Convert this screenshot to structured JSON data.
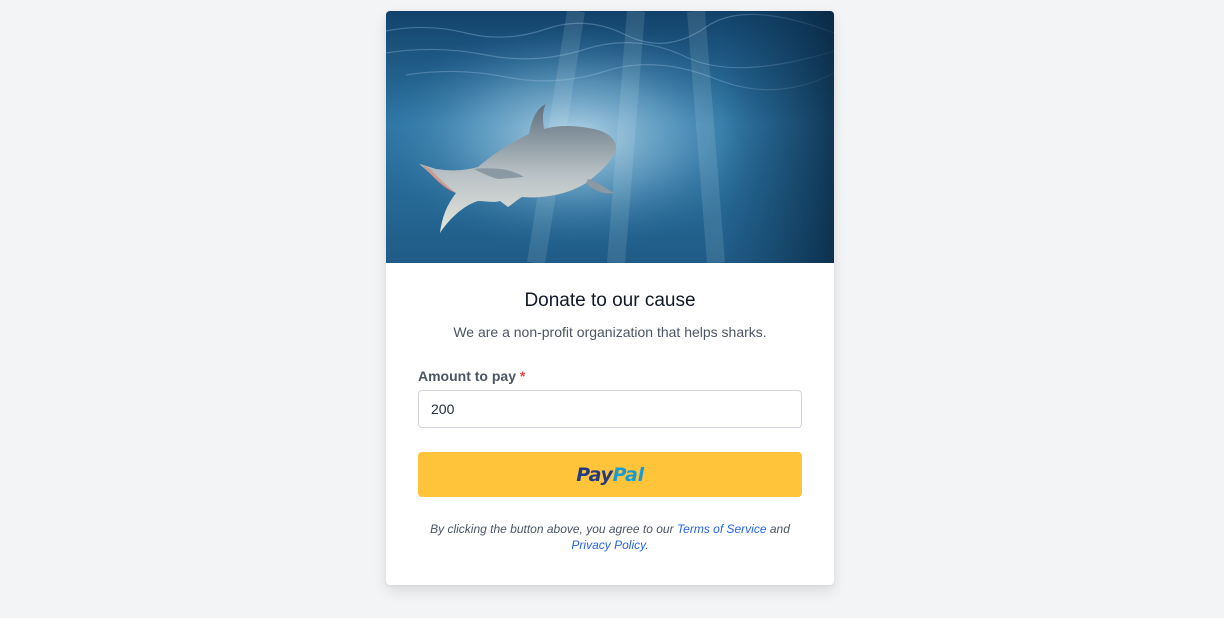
{
  "donation": {
    "hero_image_icon": "shark-underwater-image",
    "title": "Donate to our cause",
    "subtitle": "We are a non-profit organization that helps sharks.",
    "amount_label": "Amount to pay",
    "required_marker": "*",
    "amount_value": "200",
    "paypal_button": {
      "label_part1": "Pay",
      "label_part2": "Pal"
    },
    "terms": {
      "text_before": "By clicking the button above, you agree to our ",
      "terms_link": "Terms of Service",
      "text_middle": " and",
      "privacy_link": "Privacy Policy",
      "text_after": "."
    }
  },
  "colors": {
    "page_background": "#f3f4f6",
    "paypal_yellow": "#ffc439",
    "paypal_dark_blue": "#253b80",
    "paypal_light_blue": "#179bd7",
    "link_blue": "#2563eb",
    "required_red": "#ef4444"
  }
}
